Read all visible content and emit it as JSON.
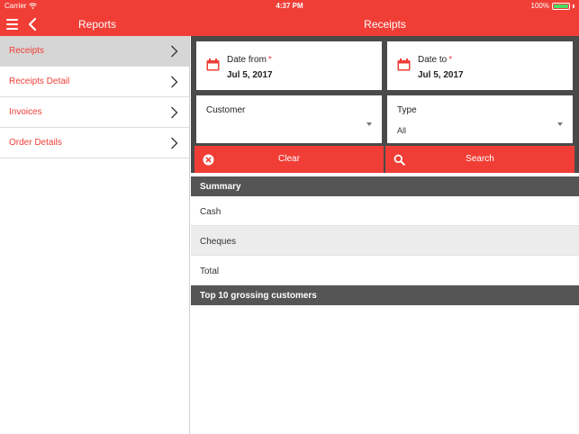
{
  "status_bar": {
    "carrier": "Carrier",
    "time": "4:37 PM",
    "battery": "100%"
  },
  "nav": {
    "left_title": "Reports",
    "right_title": "Receipts"
  },
  "sidebar": {
    "items": [
      {
        "label": "Receipts",
        "active": true
      },
      {
        "label": "Receipts Detail"
      },
      {
        "label": "Invoices"
      },
      {
        "label": "Order Details"
      }
    ]
  },
  "filters": {
    "date_from": {
      "label": "Date from",
      "required_mark": "*",
      "value": "Jul 5, 2017"
    },
    "date_to": {
      "label": "Date to",
      "required_mark": "*",
      "value": "Jul 5, 2017"
    },
    "customer": {
      "label": "Customer",
      "value": ""
    },
    "type": {
      "label": "Type",
      "value": "All"
    }
  },
  "actions": {
    "clear_label": "Clear",
    "search_label": "Search"
  },
  "summary": {
    "title": "Summary",
    "rows": [
      "Cash",
      "Cheques",
      "Total"
    ]
  },
  "top_customers": {
    "title": "Top 10 grossing customers"
  },
  "colors": {
    "accent": "#f03e36",
    "header_dark": "#555555",
    "active_row": "#d6d6d6"
  },
  "icons": {
    "menu": "hamburger-icon",
    "back": "chevron-left-icon",
    "calendar": "calendar-icon",
    "clear": "clear-circle-icon",
    "search": "search-icon",
    "chevron": "chevron-right-icon"
  }
}
